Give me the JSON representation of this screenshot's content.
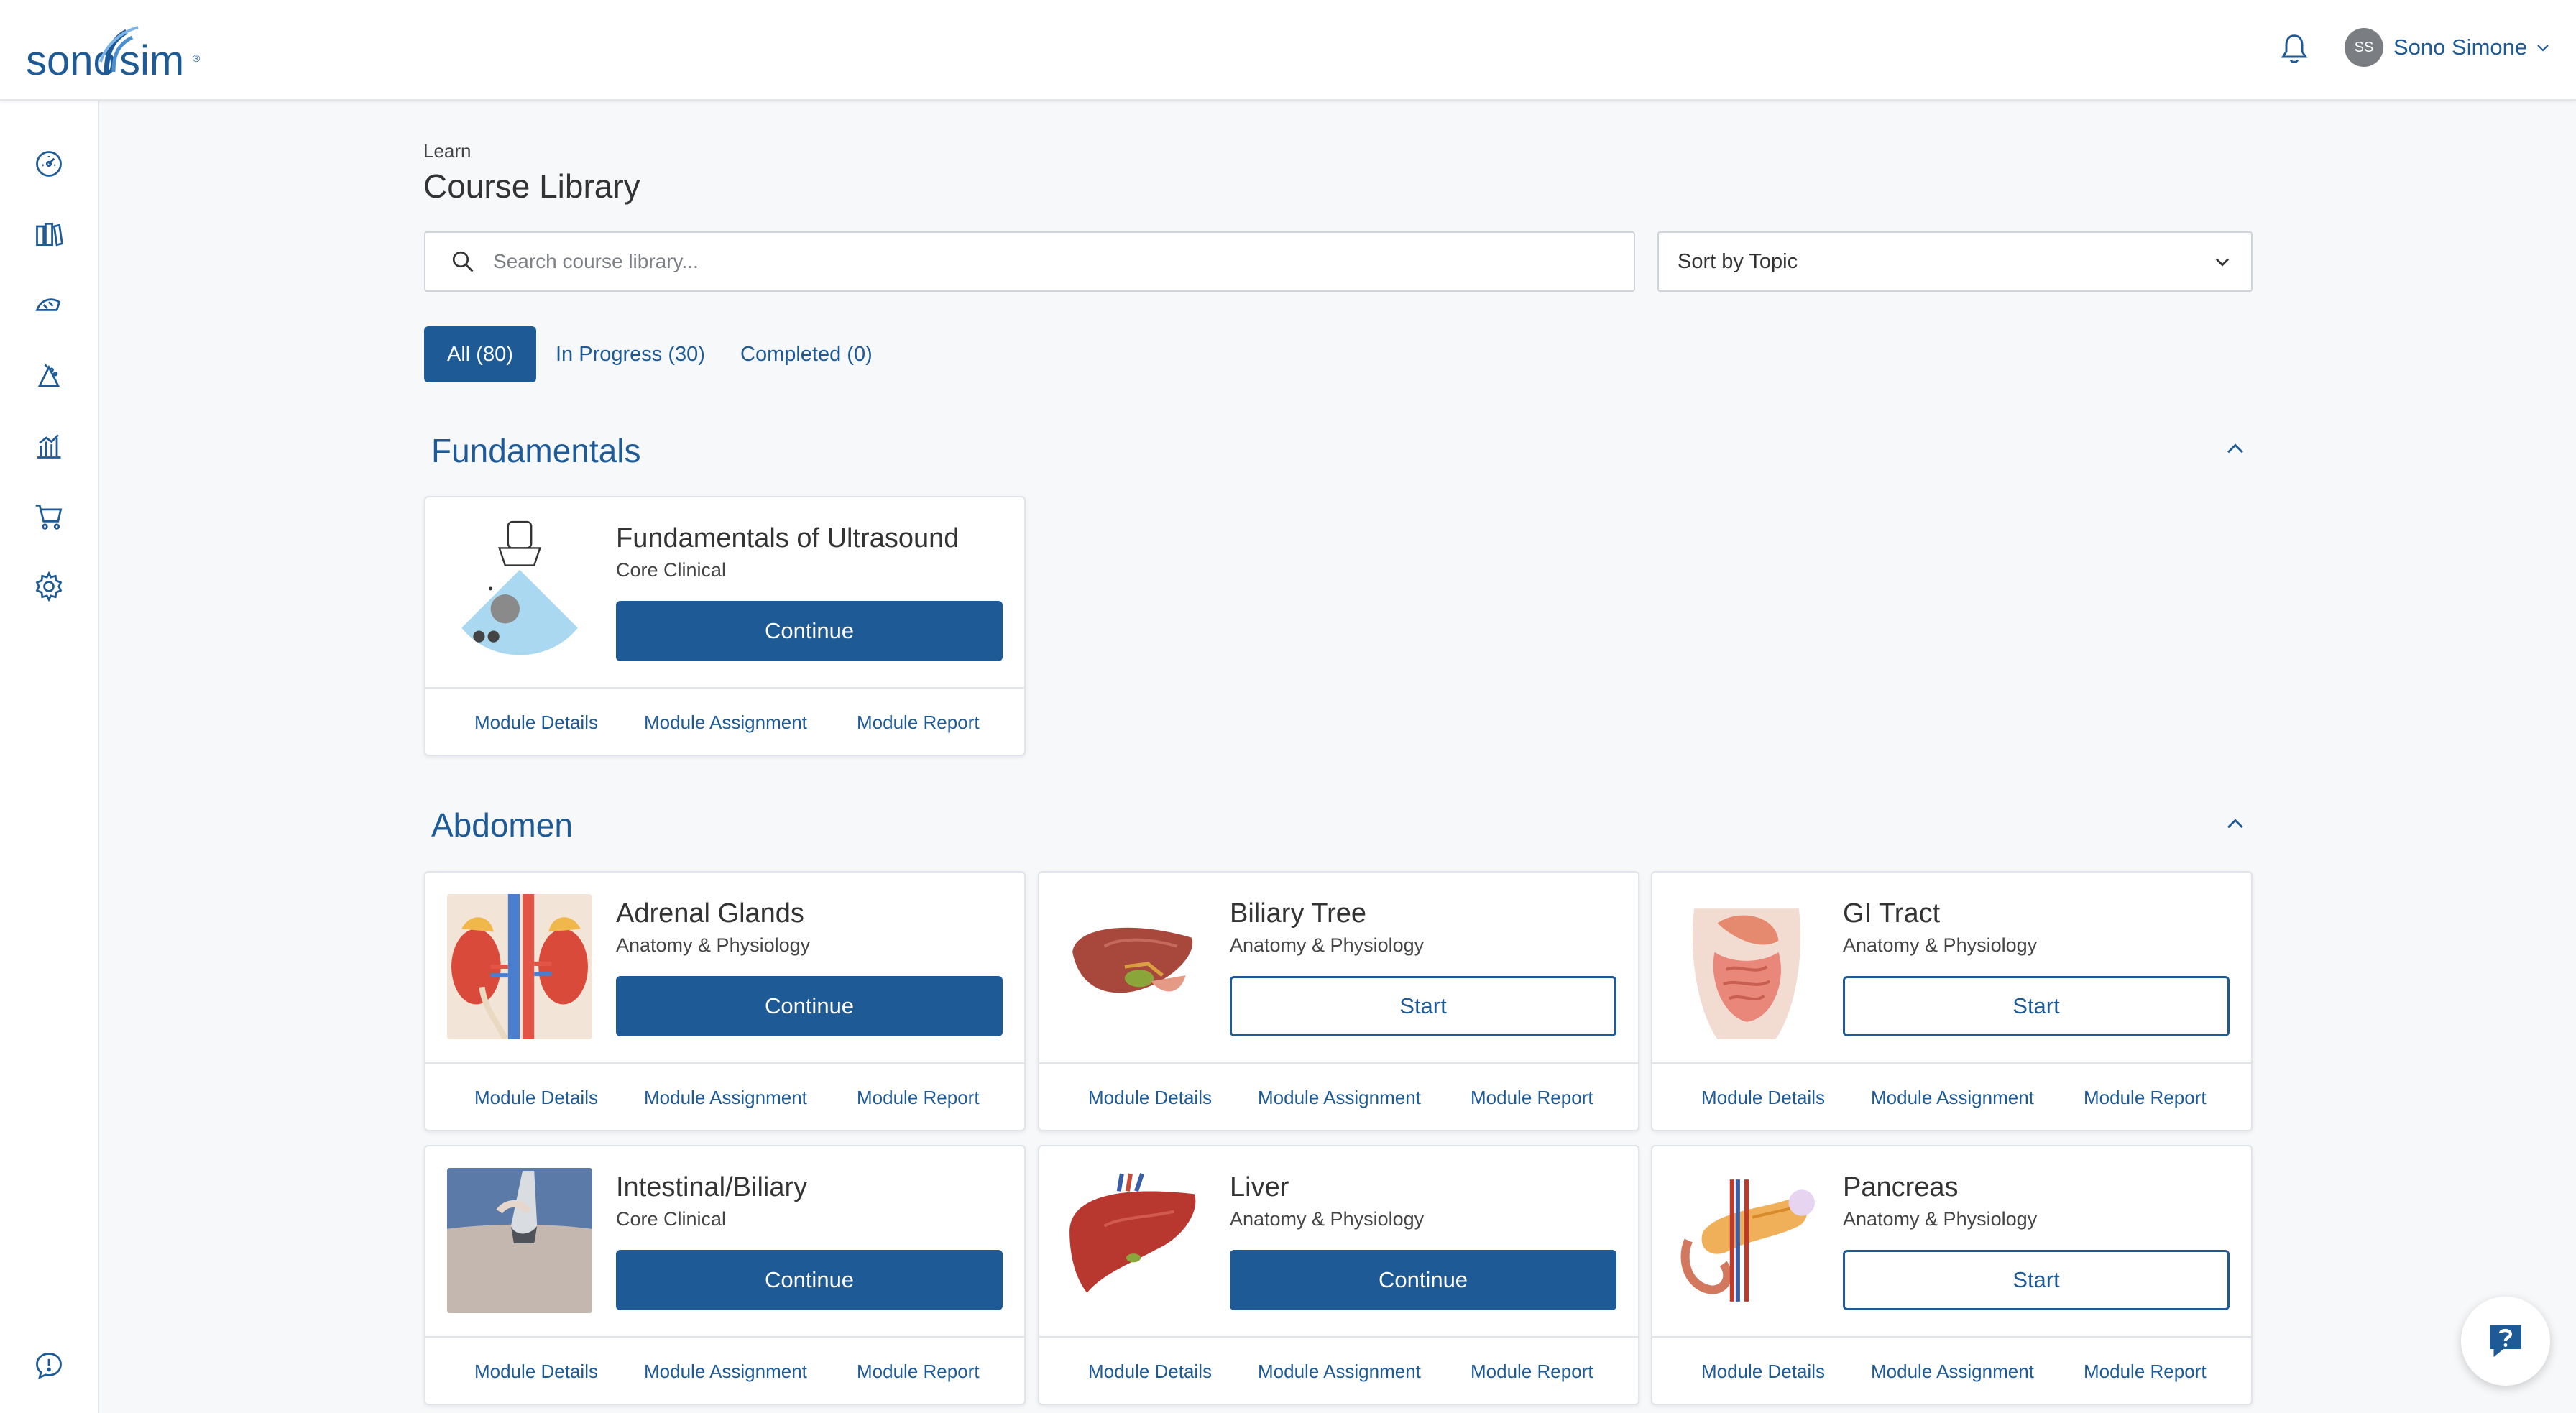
{
  "brand": {
    "name": "sonosim",
    "color": "#1e5a96"
  },
  "header": {
    "user_initials": "SS",
    "user_name": "Sono Simone"
  },
  "sidebar": {
    "items": [
      {
        "icon": "dashboard-icon"
      },
      {
        "icon": "library-icon"
      },
      {
        "icon": "probe-icon"
      },
      {
        "icon": "scan-icon"
      },
      {
        "icon": "analytics-icon"
      },
      {
        "icon": "cart-icon"
      },
      {
        "icon": "settings-icon"
      }
    ],
    "bottom_icon": "feedback-icon"
  },
  "page": {
    "breadcrumb": "Learn",
    "title": "Course Library"
  },
  "search": {
    "placeholder": "Search course library..."
  },
  "sort": {
    "selected": "Sort by Topic"
  },
  "tabs": [
    {
      "label": "All (80)",
      "active": true
    },
    {
      "label": "In Progress (30)",
      "active": false
    },
    {
      "label": "Completed (0)",
      "active": false
    }
  ],
  "sections": [
    {
      "title": "Fundamentals",
      "cards": [
        {
          "title": "Fundamentals of Ultrasound",
          "subtitle": "Core Clinical",
          "action": "Continue",
          "action_style": "primary"
        }
      ]
    },
    {
      "title": "Abdomen",
      "cards": [
        {
          "title": "Adrenal Glands",
          "subtitle": "Anatomy & Physiology",
          "action": "Continue",
          "action_style": "primary"
        },
        {
          "title": "Biliary Tree",
          "subtitle": "Anatomy & Physiology",
          "action": "Start",
          "action_style": "outline"
        },
        {
          "title": "GI Tract",
          "subtitle": "Anatomy & Physiology",
          "action": "Start",
          "action_style": "outline"
        },
        {
          "title": "Intestinal/Biliary",
          "subtitle": "Core Clinical",
          "action": "Continue",
          "action_style": "primary"
        },
        {
          "title": "Liver",
          "subtitle": "Anatomy & Physiology",
          "action": "Continue",
          "action_style": "primary"
        },
        {
          "title": "Pancreas",
          "subtitle": "Anatomy & Physiology",
          "action": "Start",
          "action_style": "outline"
        }
      ]
    }
  ],
  "card_links": {
    "details": "Module Details",
    "assignment": "Module Assignment",
    "report": "Module Report"
  }
}
